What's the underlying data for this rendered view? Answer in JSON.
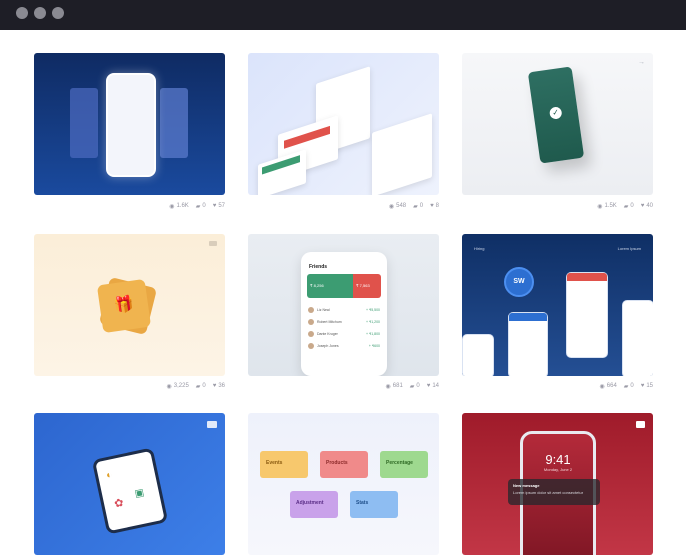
{
  "window": {
    "controls": [
      "close",
      "minimize",
      "maximize"
    ]
  },
  "cards": [
    {
      "stats": {
        "views": "1.6K",
        "comments": "0",
        "likes": "57"
      }
    },
    {
      "stats": {
        "views": "548",
        "comments": "0",
        "likes": "8"
      }
    },
    {
      "stats": {
        "views": "1.5K",
        "comments": "0",
        "likes": "40"
      }
    },
    {
      "stats": {
        "views": "3,225",
        "comments": "0",
        "likes": "36"
      }
    },
    {
      "stats": {
        "views": "681",
        "comments": "0",
        "likes": "14"
      },
      "mockup": {
        "title": "Friends",
        "balance_positive": "₹ 8,256",
        "balance_negative": "₹ 7,563",
        "rows": [
          {
            "name": "Liz Neal",
            "amount": "+ ₹5,500"
          },
          {
            "name": "Robert Mitchum",
            "amount": "+ ₹1,200"
          },
          {
            "name": "Dante Kruger",
            "amount": "+ ₹1,800"
          },
          {
            "name": "Joseph Jones",
            "amount": "+ ₹600"
          }
        ]
      }
    },
    {
      "stats": {
        "views": "664",
        "comments": "0",
        "likes": "15"
      },
      "mockup": {
        "logo_text": "SW",
        "label_left": "Hiring",
        "label_right": "Lorem Ipsum"
      }
    },
    {
      "stats": {}
    },
    {
      "stats": {},
      "mockup": {
        "tiles": [
          "Events",
          "Products",
          "Percentage",
          "Adjustment",
          "Stats"
        ]
      }
    },
    {
      "stats": {},
      "mockup": {
        "time": "9:41",
        "date": "Monday, June 2",
        "notification_title": "New message",
        "notification_body": "Lorem ipsum dolor sit amet consectetur"
      }
    }
  ],
  "colors": {
    "titlebar": "#1e1e26",
    "stat_text": "#9a9aa6"
  }
}
